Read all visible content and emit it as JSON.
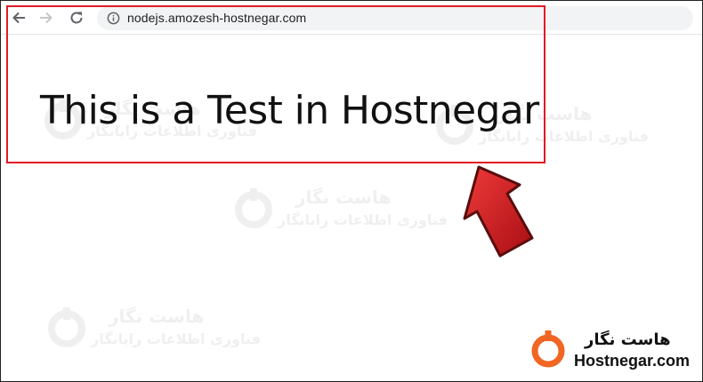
{
  "browser": {
    "url": "nodejs.amozesh-hostnegar.com",
    "back_icon": "arrow-left-icon",
    "forward_icon": "arrow-right-icon",
    "reload_icon": "reload-icon",
    "site_info_icon": "info-circle-icon"
  },
  "page": {
    "heading": "This is a Test in Hostnegar"
  },
  "watermark": {
    "title_fa": "هاست نگار",
    "subtitle_fa": "فناوری اطلاعات رایانگار"
  },
  "brand": {
    "name_fa": "هاست نگار",
    "name_en": "Hostnegar.com",
    "logo_color": "#f26522"
  },
  "highlight": {
    "box_color": "#e01b24",
    "arrow_color": "#d9161e"
  }
}
